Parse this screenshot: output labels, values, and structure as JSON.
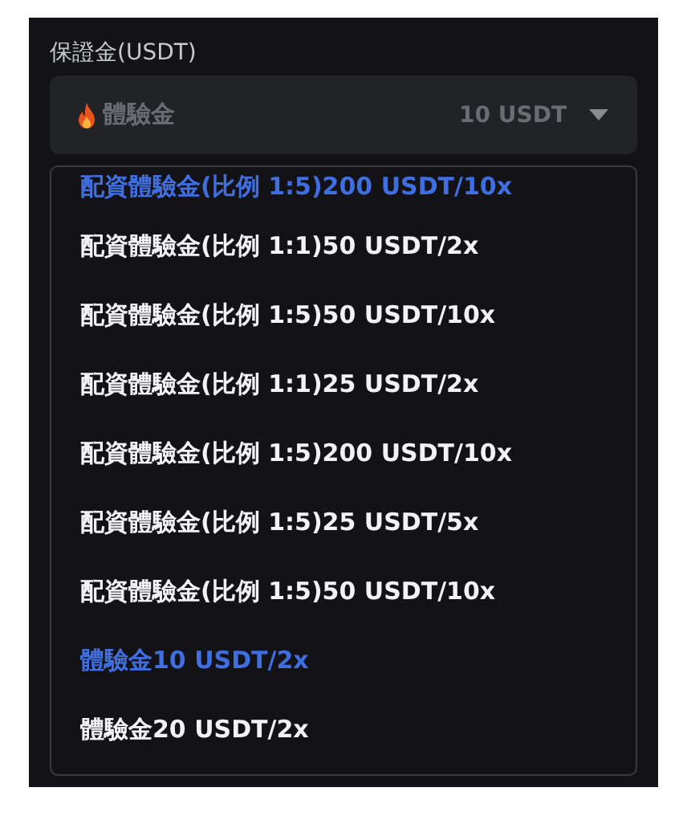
{
  "field": {
    "label": "保證金(USDT)",
    "value": "體驗金",
    "amount": "10 USDT"
  },
  "options": [
    {
      "label": "配資體驗金(比例 1:5)200 USDT/10x",
      "selected": true
    },
    {
      "label": "配資體驗金(比例 1:1)50 USDT/2x",
      "selected": false
    },
    {
      "label": "配資體驗金(比例 1:5)50 USDT/10x",
      "selected": false
    },
    {
      "label": "配資體驗金(比例 1:1)25 USDT/2x",
      "selected": false
    },
    {
      "label": "配資體驗金(比例 1:5)200 USDT/10x",
      "selected": false
    },
    {
      "label": "配資體驗金(比例 1:5)25 USDT/5x",
      "selected": false
    },
    {
      "label": "配資體驗金(比例 1:5)50 USDT/10x",
      "selected": false
    },
    {
      "label": "體驗金10 USDT/2x",
      "selected": true
    },
    {
      "label": "體驗金20 USDT/2x",
      "selected": false
    }
  ]
}
